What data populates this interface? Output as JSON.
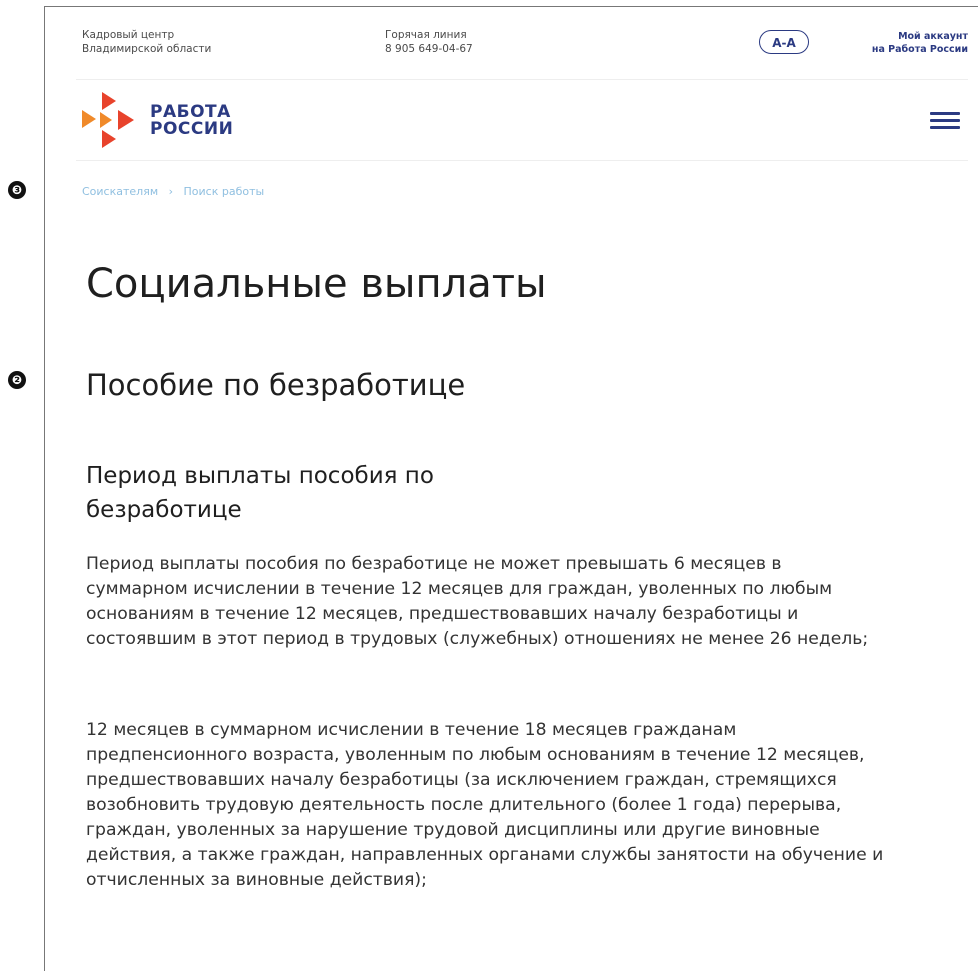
{
  "markers": {
    "breadcrumb_marker": "❸",
    "section_marker": "❷"
  },
  "topbar": {
    "org_line1": "Кадровый центр",
    "org_line2": "Владимирской области",
    "hotline_label": "Горячая линия",
    "hotline_phone": "8 905 649-04-67",
    "font_toggle": "A-A",
    "account_line1": "Мой аккаунт",
    "account_line2": "на Работа России"
  },
  "logo": {
    "line1": "РАБОТА",
    "line2": "РОССИИ",
    "colors": {
      "red": "#e8432c",
      "orange": "#f08a2a",
      "blue": "#2b3a82"
    }
  },
  "breadcrumb": {
    "items": [
      "Соискателям",
      "Поиск работы"
    ],
    "separator": "›"
  },
  "page": {
    "title": "Социальные выплаты",
    "section_title": "Пособие по безработице",
    "subsection_title": "Период выплаты пособия по безработице",
    "paragraphs": [
      "Период выплаты пособия по безработице не может превышать 6 месяцев в суммарном исчислении в течение 12 месяцев для граждан, уволенных по любым основаниям в течение 12 месяцев, предшествовавших началу безработицы и состоявшим в этот период в трудовых (служебных) отношениях не менее 26 недель;",
      "12 месяцев в суммарном исчислении в течение 18 месяцев гражданам предпенсионного возраста, уволенным по любым основаниям в течение 12 месяцев, предшествовавших началу безработицы (за исключением граждан, стремящихся возобновить трудовую деятельность после длительного (более 1 года) перерыва, граждан, уволенных за нарушение трудовой дисциплины или другие виновные действия, а также граждан, направленных органами службы занятости на обучение и отчисленных за виновные действия);"
    ]
  }
}
